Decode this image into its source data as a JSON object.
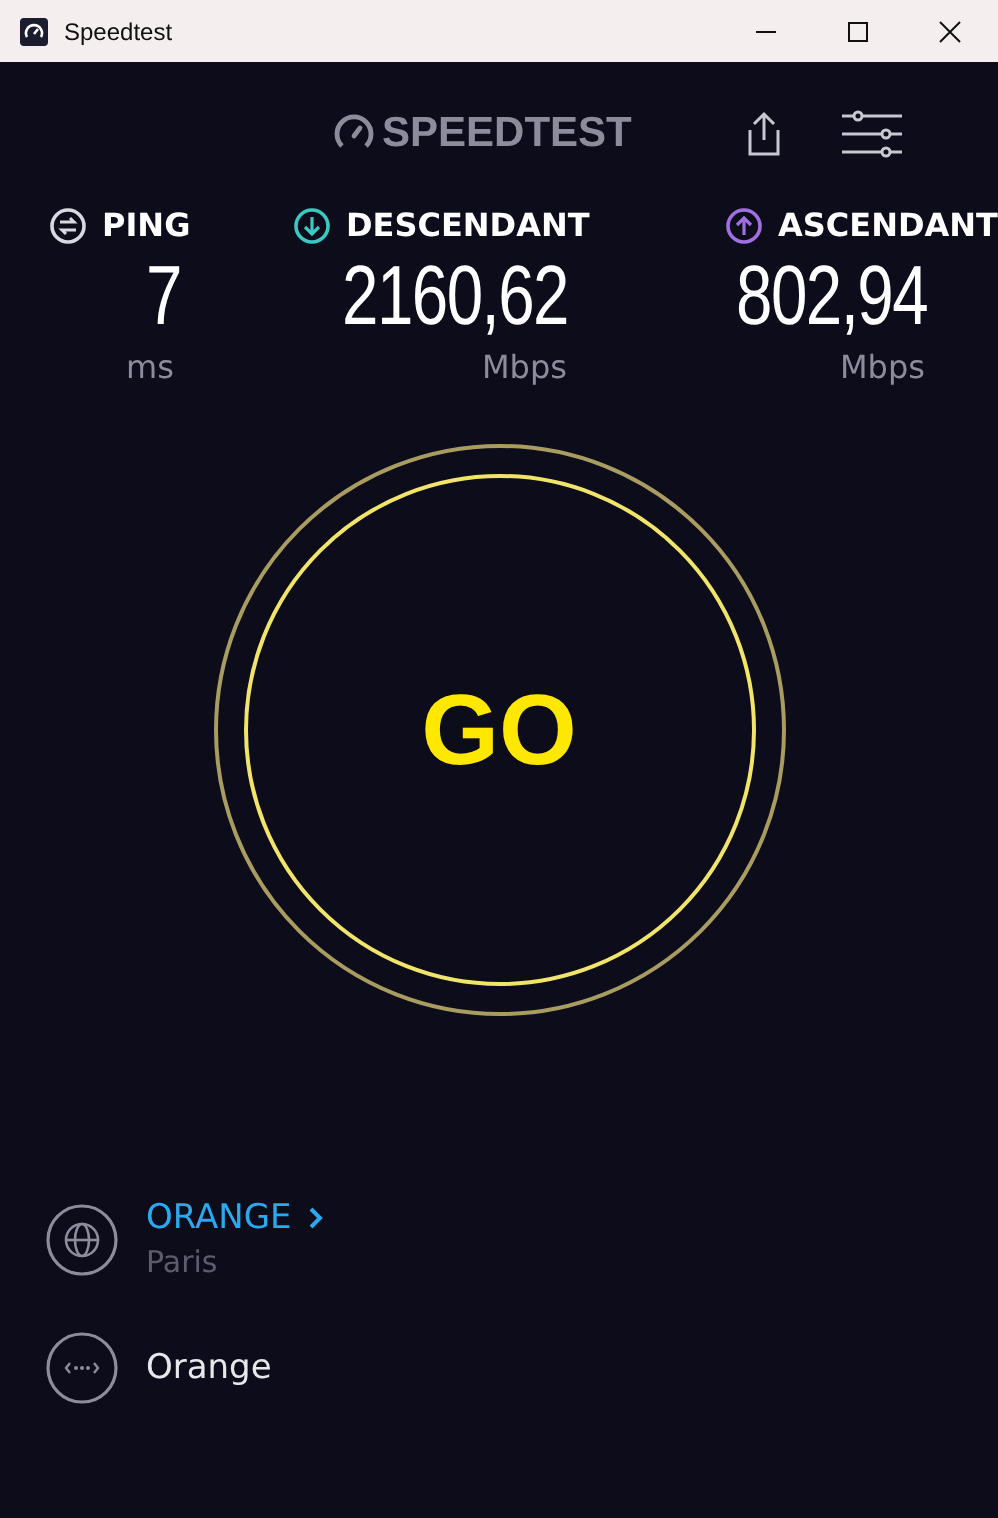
{
  "window": {
    "title": "Speedtest"
  },
  "logo": {
    "text": "SPEEDTEST"
  },
  "metrics": [
    {
      "kind": "ping",
      "label": "PING",
      "value": "7",
      "unit": "ms"
    },
    {
      "kind": "download",
      "label": "DESCENDANT",
      "value": "2160,62",
      "unit": "Mbps"
    },
    {
      "kind": "upload",
      "label": "ASCENDANT",
      "value": "802,94",
      "unit": "Mbps"
    }
  ],
  "go_button": {
    "label": "GO"
  },
  "provider": {
    "name": "ORANGE",
    "location": "Paris"
  },
  "connection": {
    "name": "Orange"
  }
}
